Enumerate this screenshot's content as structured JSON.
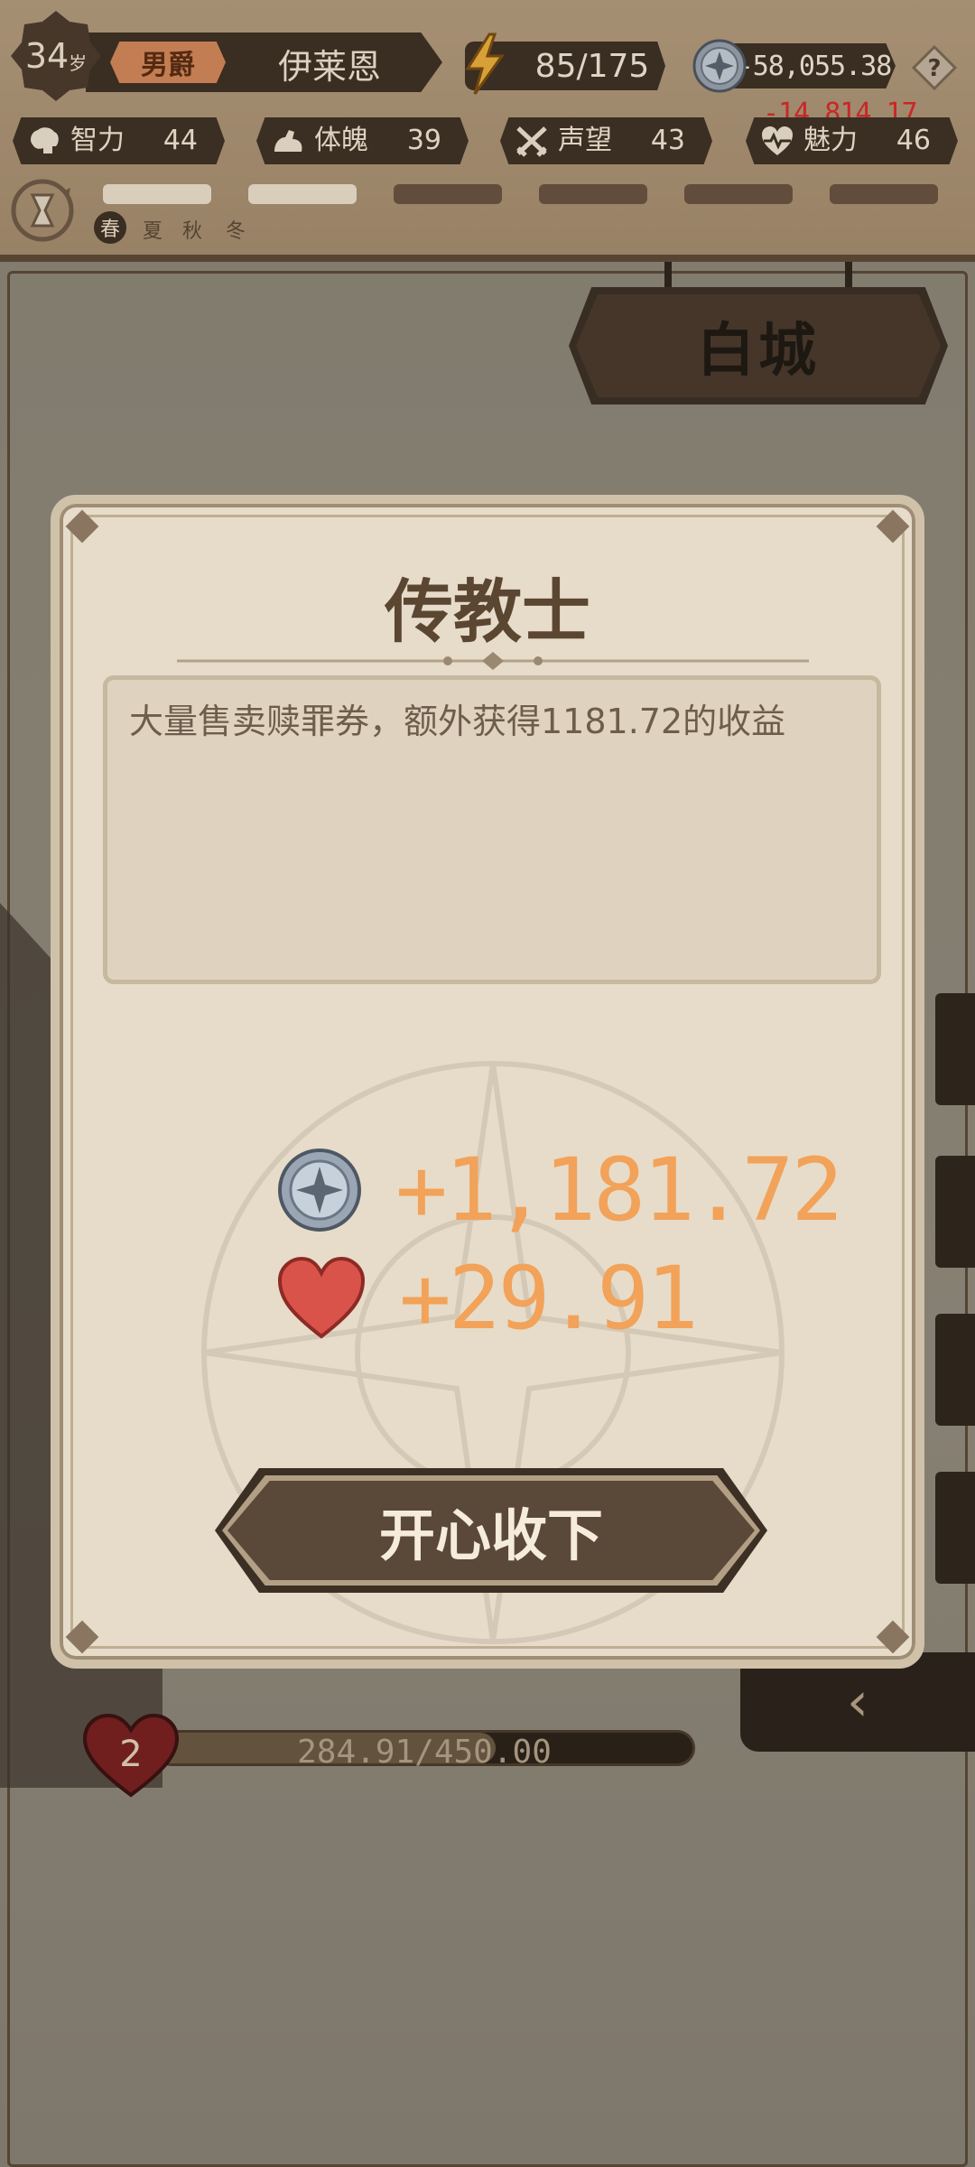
{
  "header": {
    "age": "34",
    "age_unit": "岁",
    "title_badge": "男爵",
    "player_name": "伊莱恩",
    "energy": "85/175",
    "coins": "-58,055.38",
    "coins_delta": "-14,814.17",
    "help_icon": "question-icon"
  },
  "stats": [
    {
      "label": "智力",
      "value": "44",
      "icon": "brain-icon"
    },
    {
      "label": "体魄",
      "value": "39",
      "icon": "muscle-icon"
    },
    {
      "label": "声望",
      "value": "43",
      "icon": "crossed-swords-icon"
    },
    {
      "label": "魅力",
      "value": "46",
      "icon": "heartbeat-icon"
    }
  ],
  "seasons": {
    "current": "春",
    "others": [
      "夏",
      "秋",
      "冬"
    ],
    "progress_filled": 2,
    "progress_total": 6
  },
  "location_sign": "白城",
  "health_bar": {
    "level": "2",
    "text": "284.91/450.00",
    "fill_fraction": 0.633
  },
  "dialog": {
    "title": "传教士",
    "description": "大量售卖赎罪券，额外获得1181.72的收益",
    "rewards": [
      {
        "icon": "silver-coin-icon",
        "amount": "+1,181.72"
      },
      {
        "icon": "heart-icon",
        "amount": "+29.91"
      }
    ],
    "accept_label": "开心收下"
  },
  "colors": {
    "reward_text": "#f2a259",
    "coin_delta": "#e0282a",
    "panel_dark": "#3d2f23",
    "dialog_bg": "#e6dcc9"
  }
}
